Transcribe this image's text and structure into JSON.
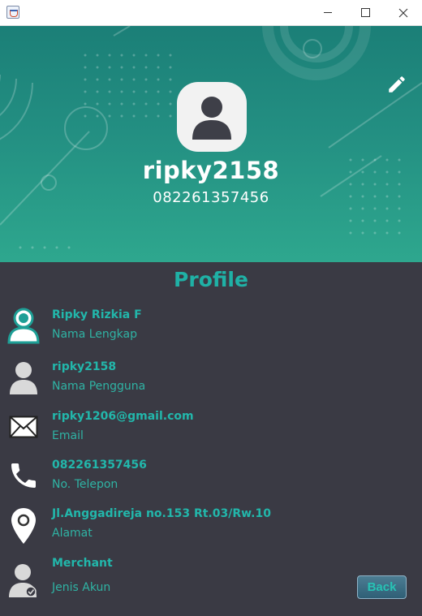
{
  "window": {
    "icon": "java-app-icon",
    "controls": [
      "minimize",
      "maximize",
      "close"
    ]
  },
  "header": {
    "username": "ripky2158",
    "phone": "082261357456",
    "avatar_icon": "user-avatar-icon",
    "edit_icon": "pencil-icon",
    "gradient_colors": [
      "#1b7f77",
      "#2ea78e"
    ]
  },
  "profile": {
    "title": "Profile",
    "rows": [
      {
        "value": "Ripky Rizkia F",
        "label": "Nama Lengkap",
        "icon": "person-icon"
      },
      {
        "value": "ripky2158",
        "label": "Nama Pengguna",
        "icon": "user-icon"
      },
      {
        "value": "ripky1206@gmail.com",
        "label": "Email",
        "icon": "envelope-icon"
      },
      {
        "value": "082261357456",
        "label": "No. Telepon",
        "icon": "phone-icon"
      },
      {
        "value": "Jl.Anggadireja no.153 Rt.03/Rw.10",
        "label": "Alamat",
        "icon": "location-pin-icon"
      },
      {
        "value": "Merchant",
        "label": "Jenis Akun",
        "icon": "verified-user-icon"
      }
    ]
  },
  "actions": {
    "back_label": "Back"
  },
  "colors": {
    "accent": "#22b7ab",
    "panel_background": "#3a3a44",
    "header_text": "#ffffff"
  }
}
